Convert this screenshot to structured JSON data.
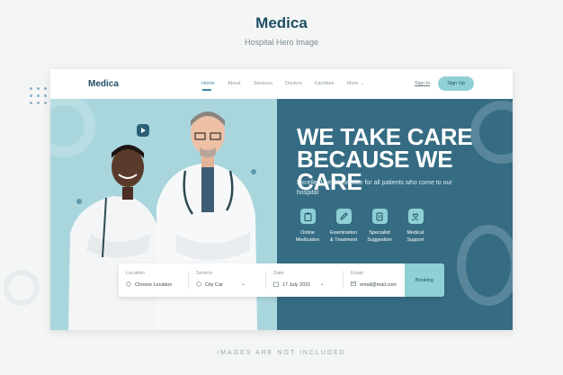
{
  "showcase": {
    "title": "Medica",
    "subtitle": "Hospital Hero Image",
    "footnote": "IMAGES ARE NOT INCLUDED"
  },
  "navbar": {
    "logo": "Medica",
    "links": [
      {
        "label": "Home",
        "active": true
      },
      {
        "label": "About",
        "active": false
      },
      {
        "label": "Services",
        "active": false
      },
      {
        "label": "Doctors",
        "active": false
      },
      {
        "label": "Facilities",
        "active": false
      },
      {
        "label": "More",
        "active": false
      }
    ],
    "signin": "Sign In",
    "signup": "Sign Up"
  },
  "hero": {
    "headline_line1": "WE TAKE CARE",
    "headline_line2": "BECAUSE WE CARE",
    "subtext": "Excellent health service for all patients who come to our hospital",
    "features": [
      {
        "icon": "clipboard-icon",
        "line1": "Online",
        "line2": "Medication"
      },
      {
        "icon": "pen-icon",
        "line1": "Examination",
        "line2": "& Treatment"
      },
      {
        "icon": "document-icon",
        "line1": "Specialist",
        "line2": "Suggestion"
      },
      {
        "icon": "hand-support-icon",
        "line1": "Medical",
        "line2": "Support"
      }
    ]
  },
  "booking": {
    "location": {
      "label": "Location",
      "value": "Choose Location"
    },
    "service": {
      "label": "Service",
      "value": "City Car"
    },
    "date": {
      "label": "Date",
      "value": "17 July 2021"
    },
    "email": {
      "label": "Email",
      "value": "email@mail.com"
    },
    "button": "Booking"
  },
  "colors": {
    "brand_dark": "#1e4d63",
    "hero_left": "#a9d6dd",
    "hero_right": "#356c84",
    "accent": "#8fd0d6"
  }
}
